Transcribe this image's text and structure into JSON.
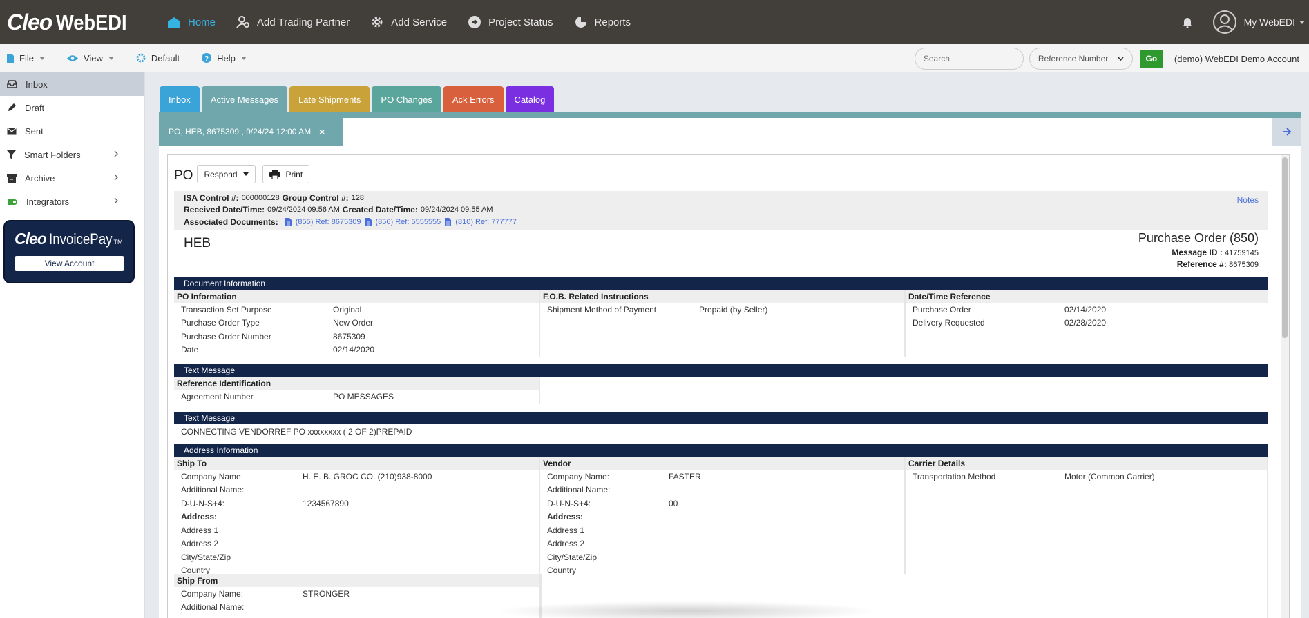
{
  "app": {
    "logo_cleo": "Cleo",
    "logo_webedi": "WebEDI"
  },
  "topnav": {
    "links": [
      {
        "label": "Home",
        "icon": "home-icon"
      },
      {
        "label": "Add Trading Partner",
        "icon": "add-user-icon"
      },
      {
        "label": "Add Service",
        "icon": "gear-icon"
      },
      {
        "label": "Project Status",
        "icon": "arrow-circle-icon"
      },
      {
        "label": "Reports",
        "icon": "pie-chart-icon"
      }
    ],
    "account_label": "My WebEDI"
  },
  "menubar": {
    "file": "File",
    "view": "View",
    "default": "Default",
    "help": "Help",
    "search_placeholder": "Search",
    "search_type": "Reference Number",
    "go": "Go",
    "account": "(demo) WebEDI Demo Account"
  },
  "sidebar": {
    "items": [
      {
        "label": "Inbox",
        "icon": "inbox-icon",
        "active": true
      },
      {
        "label": "Draft",
        "icon": "pencil-icon"
      },
      {
        "label": "Sent",
        "icon": "envelope-icon"
      },
      {
        "label": "Smart Folders",
        "icon": "filter-icon"
      },
      {
        "label": "Archive",
        "icon": "archive-icon"
      },
      {
        "label": "Integrators",
        "icon": "integrators-icon"
      }
    ],
    "invoicepay": {
      "cleo": "Cleo",
      "name": "InvoicePay",
      "tm": "TM",
      "button": "View Account"
    }
  },
  "tabs": [
    {
      "label": "Inbox",
      "color": "#3aa3d8"
    },
    {
      "label": "Active Messages",
      "color": "#6fa7ad"
    },
    {
      "label": "Late Shipments",
      "color": "#c9a23a"
    },
    {
      "label": "PO Changes",
      "color": "#5aa59c"
    },
    {
      "label": "Ack Errors",
      "color": "#d9603c"
    },
    {
      "label": "Catalog",
      "color": "#7a2fe0"
    }
  ],
  "doctab": {
    "label": "PO, HEB, 8675309 , 9/24/24 12:00 AM",
    "close": "×"
  },
  "document": {
    "type_label": "PO",
    "respond": "Respond",
    "print": "Print",
    "meta": {
      "isa_label": "ISA Control #:",
      "isa_value": "000000128",
      "group_label": "Group Control #:",
      "group_value": "128",
      "received_label": "Received Date/Time:",
      "received_value": "09/24/2024 09:56 AM",
      "created_label": "Created Date/Time:",
      "created_value": "09/24/2024 09:55 AM",
      "assoc_label": "Associated Documents:",
      "assoc_docs": [
        "(855) Ref: 8675309",
        "(856) Ref: 5555555",
        "(810) Ref: 777777"
      ],
      "notes": "Notes"
    },
    "partner": "HEB",
    "title": "Purchase Order (850)",
    "message_id_label": "Message ID :",
    "message_id": "41759145",
    "reference_label": "Reference #:",
    "reference": "8675309",
    "sections": {
      "doc_info": "Document Information",
      "text_message_1": "Text Message",
      "text_message_2": "Text Message",
      "address_info": "Address Information"
    },
    "po_info": {
      "heading": "PO Information",
      "rows": [
        {
          "k": "Transaction Set Purpose",
          "v": "Original"
        },
        {
          "k": "Purchase Order Type",
          "v": "New Order"
        },
        {
          "k": "Purchase Order Number",
          "v": "8675309"
        },
        {
          "k": "Date",
          "v": "02/14/2020"
        }
      ]
    },
    "fob": {
      "heading": "F.O.B. Related Instructions",
      "rows": [
        {
          "k": "Shipment Method of Payment",
          "v": "Prepaid (by Seller)"
        }
      ]
    },
    "datetime_ref": {
      "heading": "Date/Time Reference",
      "rows": [
        {
          "k": "Purchase Order",
          "v": "02/14/2020"
        },
        {
          "k": "Delivery Requested",
          "v": "02/28/2020"
        }
      ]
    },
    "ref_ident": {
      "heading": "Reference Identification",
      "rows": [
        {
          "k": "Agreement Number",
          "v": "PO MESSAGES"
        }
      ]
    },
    "text_message_line": "CONNECTING VENDORREF PO xxxxxxxx ( 2 OF 2)PREPAID",
    "ship_to": {
      "heading": "Ship To",
      "rows": [
        {
          "k": "Company Name:",
          "v": "H. E. B. GROC CO. (210)938-8000"
        },
        {
          "k": "Additional Name:",
          "v": ""
        },
        {
          "k": "D-U-N-S+4:",
          "v": "1234567890"
        },
        {
          "k": "Address:",
          "v": "",
          "bold": true
        },
        {
          "k": "Address 1",
          "v": ""
        },
        {
          "k": "Address 2",
          "v": ""
        },
        {
          "k": "City/State/Zip",
          "v": ""
        },
        {
          "k": "Country",
          "v": ""
        }
      ]
    },
    "vendor": {
      "heading": "Vendor",
      "rows": [
        {
          "k": "Company Name:",
          "v": "FASTER"
        },
        {
          "k": "Additional Name:",
          "v": ""
        },
        {
          "k": "D-U-N-S+4:",
          "v": "00"
        },
        {
          "k": "Address:",
          "v": "",
          "bold": true
        },
        {
          "k": "Address 1",
          "v": ""
        },
        {
          "k": "Address 2",
          "v": ""
        },
        {
          "k": "City/State/Zip",
          "v": ""
        },
        {
          "k": "Country",
          "v": ""
        }
      ]
    },
    "carrier": {
      "heading": "Carrier Details",
      "rows": [
        {
          "k": "Transportation Method",
          "v": "Motor (Common Carrier)"
        }
      ]
    },
    "ship_from": {
      "heading": "Ship From",
      "rows": [
        {
          "k": "Company Name:",
          "v": "STRONGER"
        },
        {
          "k": "Additional Name:",
          "v": ""
        }
      ]
    }
  }
}
